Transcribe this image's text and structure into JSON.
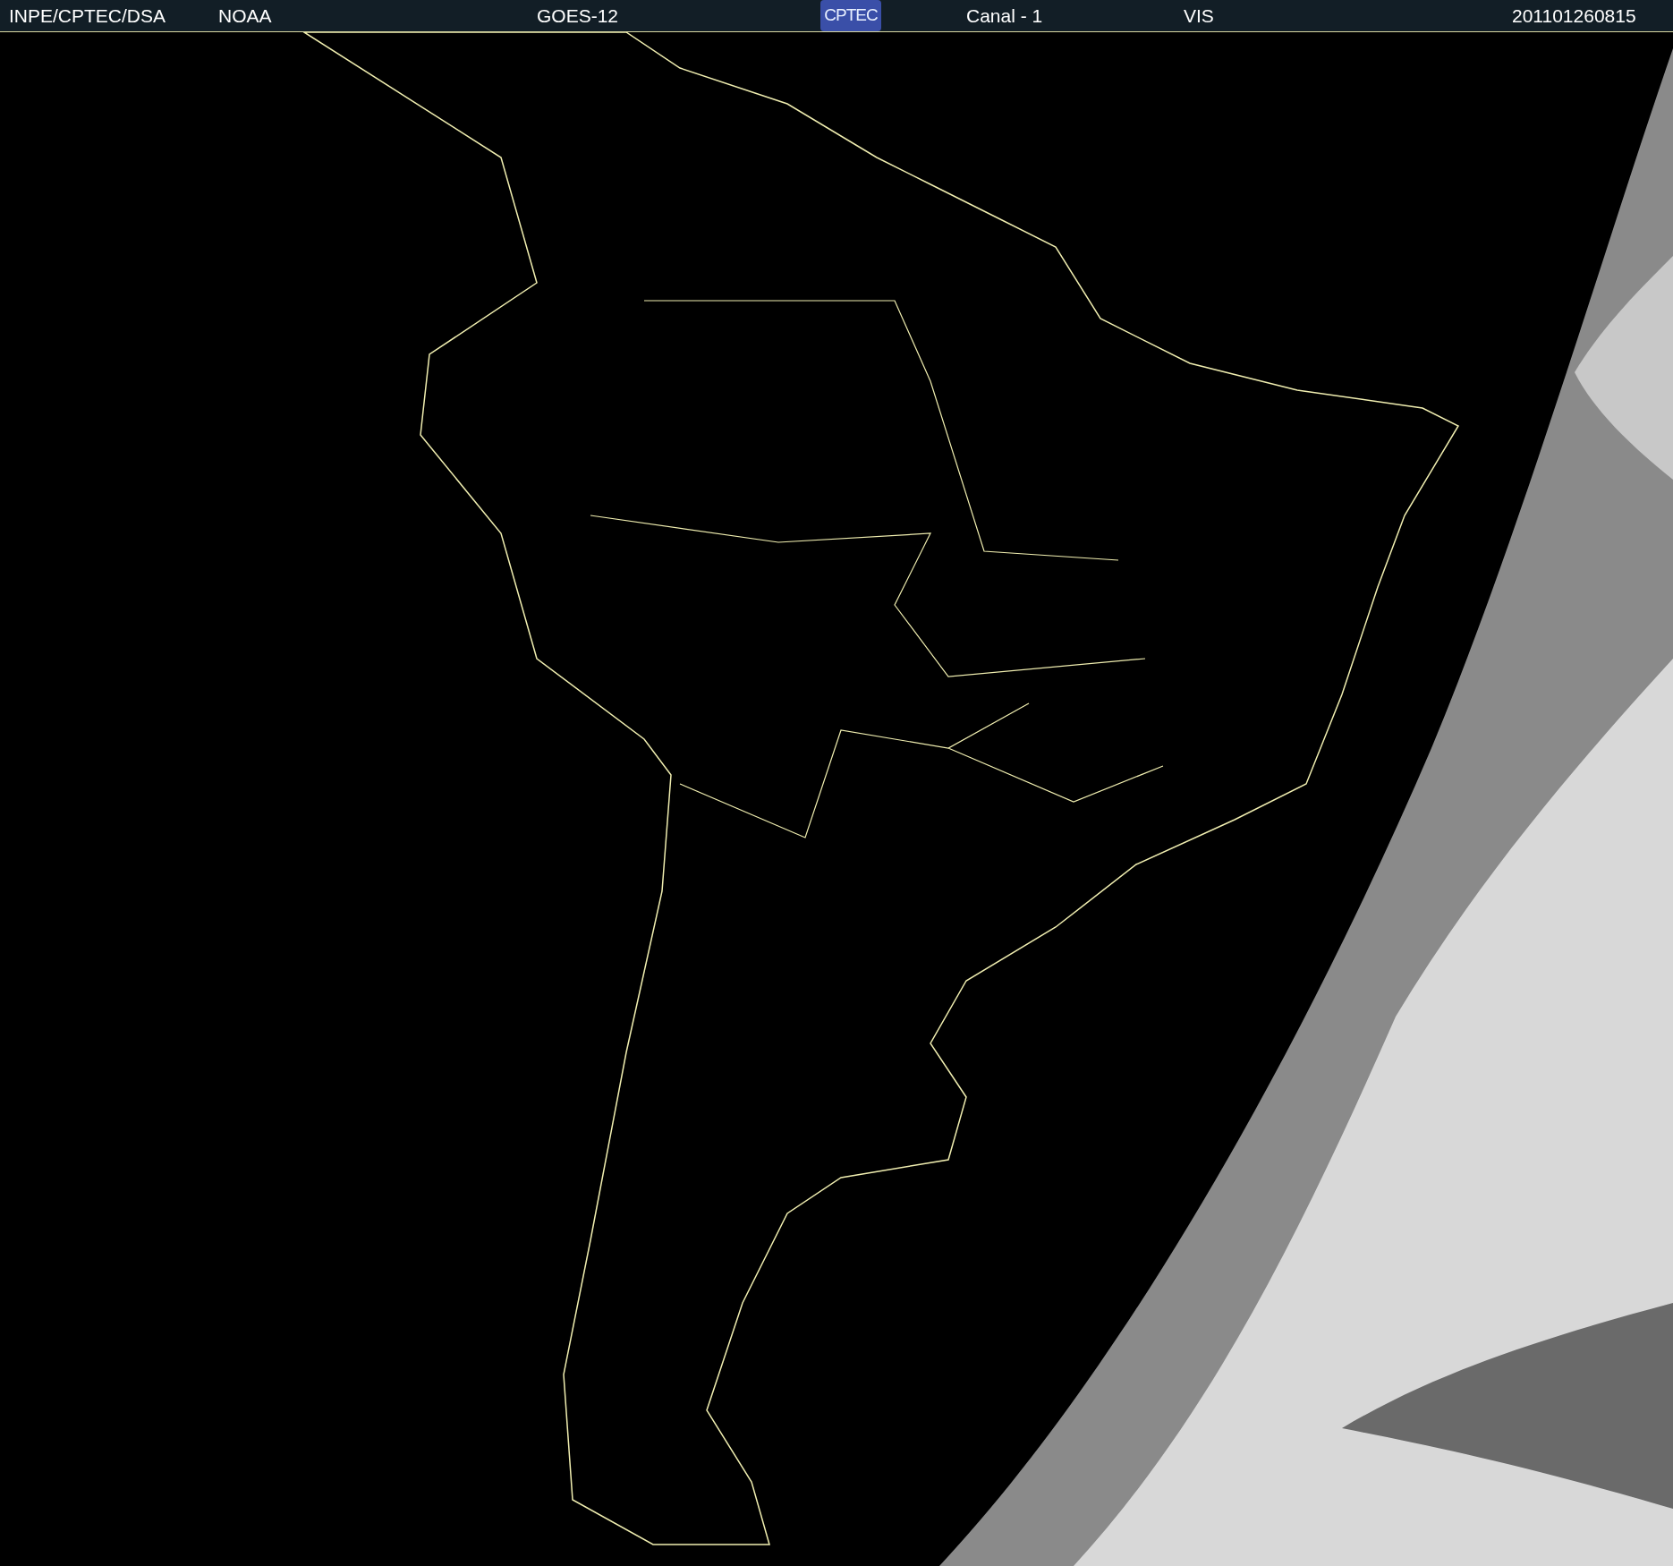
{
  "header": {
    "items": [
      {
        "kind": "text",
        "text": "INPE/CPTEC/DSA"
      },
      {
        "kind": "text",
        "text": "NOAA"
      },
      {
        "kind": "text",
        "text": "GOES-12"
      },
      {
        "kind": "logo",
        "text": "CPTEC"
      },
      {
        "kind": "text",
        "text": "Canal - 1"
      },
      {
        "kind": "text",
        "text": "VIS"
      },
      {
        "kind": "text",
        "text": "201101260815"
      }
    ]
  }
}
